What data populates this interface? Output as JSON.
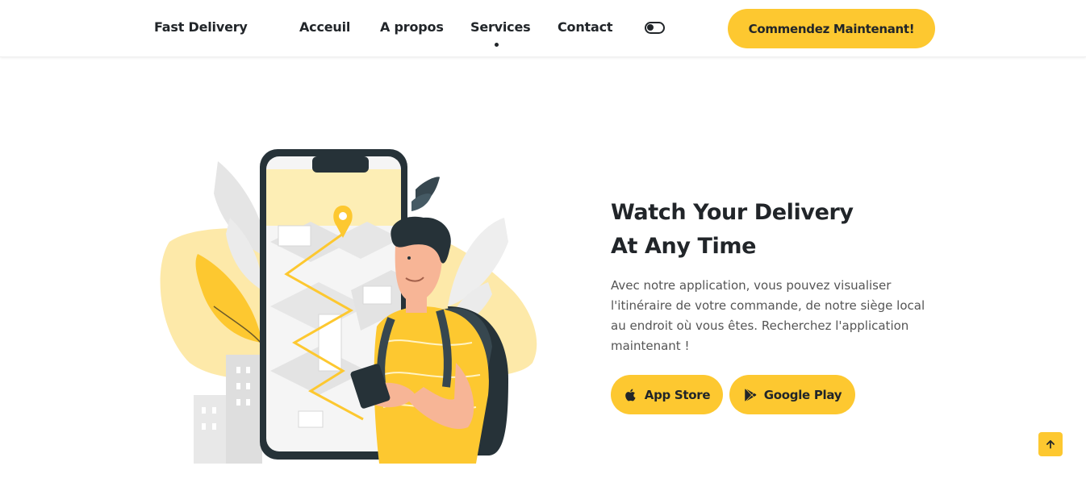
{
  "header": {
    "brand": "Fast Delivery",
    "nav": [
      "Acceuil",
      "A propos",
      "Services",
      "Contact"
    ],
    "active_nav": "Services",
    "cta_label": "Commendez Maintenant!"
  },
  "hero": {
    "title_line1": "Watch Your Delivery",
    "title_line2": "At Any Time",
    "description": "Avec notre application, vous pouvez visualiser l'itinéraire de votre commande, de notre siège local au endroit où vous êtes. Recherchez l'application maintenant !",
    "app_store_label": "App Store",
    "google_play_label": "Google Play"
  },
  "icons": {
    "theme_toggle": "toggle-icon",
    "apple": "apple-icon",
    "google_play": "google-play-icon",
    "back_to_top": "arrow-up-icon"
  },
  "colors": {
    "accent": "#fdc830",
    "text": "#212529",
    "muted": "#555555"
  }
}
